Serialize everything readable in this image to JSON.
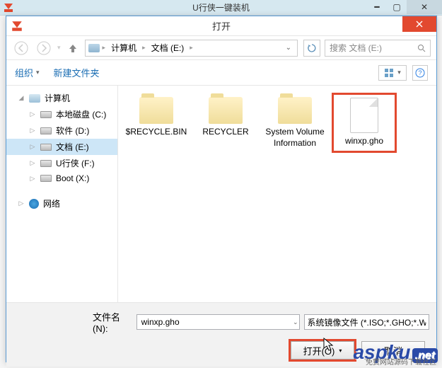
{
  "parent": {
    "title": "U行侠一键装机"
  },
  "dialog": {
    "title": "打开"
  },
  "breadcrumb": {
    "seg0": "计算机",
    "seg1": "文档 (E:)"
  },
  "search": {
    "placeholder": "搜索 文档 (E:)"
  },
  "toolbar": {
    "organize": "组织",
    "newfolder": "新建文件夹"
  },
  "tree": {
    "computer": "计算机",
    "drives": [
      {
        "label": "本地磁盘 (C:)"
      },
      {
        "label": "软件 (D:)"
      },
      {
        "label": "文档 (E:)"
      },
      {
        "label": "U行侠 (F:)"
      },
      {
        "label": "Boot (X:)"
      }
    ],
    "network": "网络"
  },
  "files": [
    {
      "name": "$RECYCLE.BIN",
      "type": "folder"
    },
    {
      "name": "RECYCLER",
      "type": "folder"
    },
    {
      "name": "System Volume Information",
      "type": "folder"
    },
    {
      "name": "winxp.gho",
      "type": "file",
      "highlight": true
    }
  ],
  "bottom": {
    "filename_label": "文件名(N):",
    "filename_value": "winxp.gho",
    "filter": "系统镜像文件 (*.ISO;*.GHO;*.WIM)",
    "open": "打开(O)",
    "cancel": "取消"
  },
  "watermark": {
    "brand": "aspku",
    "tld": ".net",
    "sub": "免费网站源码下载社区"
  }
}
